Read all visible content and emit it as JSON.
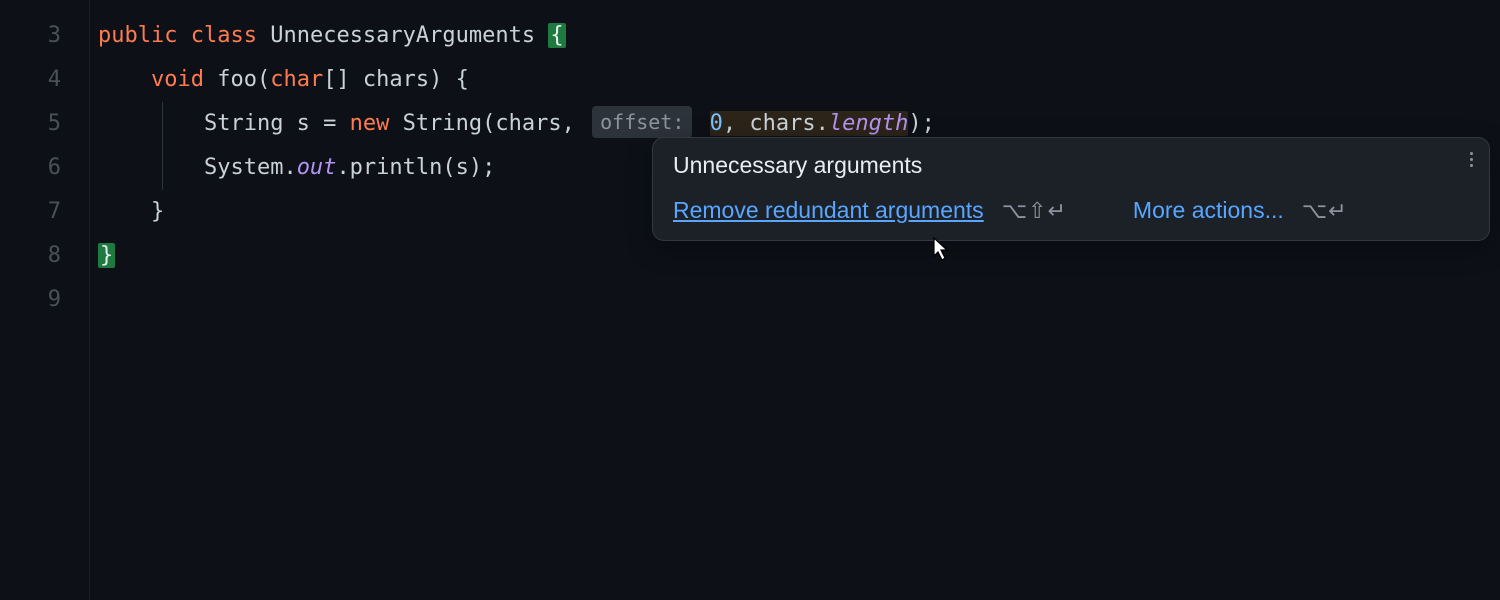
{
  "gutter": {
    "lines": [
      "3",
      "4",
      "5",
      "6",
      "7",
      "8",
      "9"
    ]
  },
  "code": {
    "line3": {
      "kw1": "public",
      "kw2": "class",
      "cls": "UnnecessaryArguments",
      "brace": "{"
    },
    "line4": {
      "indent": "    ",
      "kw": "void",
      "name": "foo(",
      "kw2": "char",
      "arr": "[] chars) {"
    },
    "line5": {
      "indent": "        ",
      "p1": "String s = ",
      "kw": "new",
      "p2": " String(chars,",
      "hint": "offset:",
      "num": "0",
      "comma": ",",
      "p3": " chars.",
      "len": "length",
      "p4": ");"
    },
    "line6": {
      "indent": "        ",
      "p1": "System.",
      "out": "out",
      "p2": ".println(s);"
    },
    "line7": {
      "indent": "    ",
      "brace": "}"
    },
    "line8": {
      "brace": "}"
    }
  },
  "tooltip": {
    "title": "Unnecessary arguments",
    "fix_label": "Remove redundant arguments",
    "fix_shortcut": "⌥⇧↵",
    "more_label": "More actions...",
    "more_shortcut": "⌥↵"
  }
}
